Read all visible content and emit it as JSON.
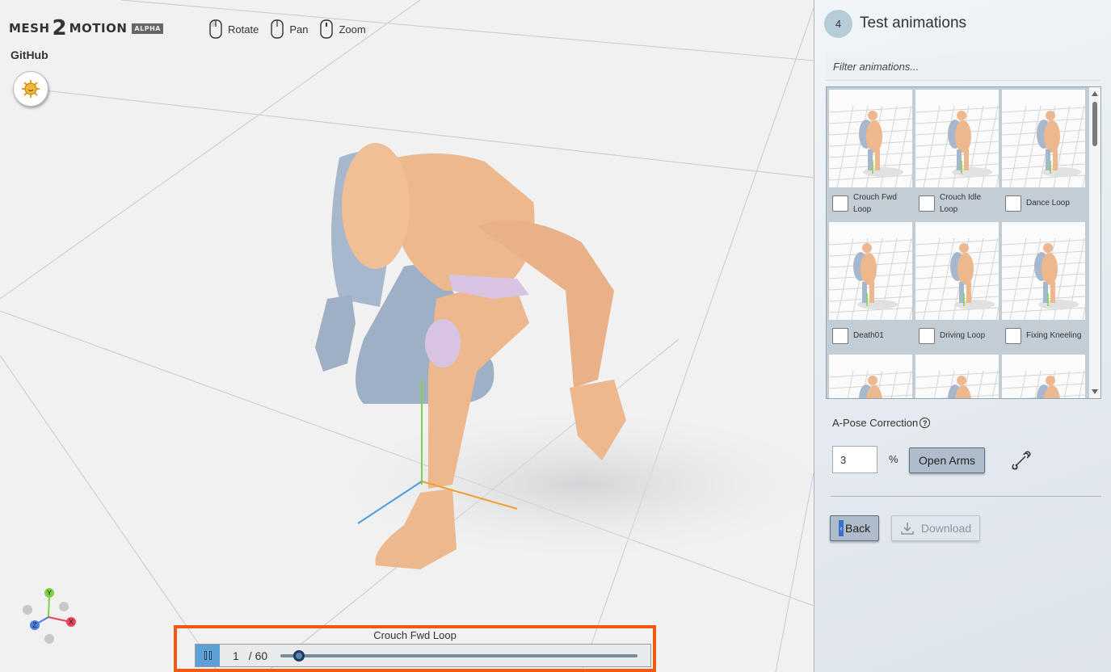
{
  "app": {
    "logo_word1": "MESH",
    "logo_two": "2",
    "logo_word2": "MOTION",
    "logo_badge": "ALPHA",
    "github_label": "GitHub",
    "theme_icon": "sun-icon"
  },
  "viewport_controls": [
    {
      "label": "Rotate",
      "icon": "mouse-left-icon"
    },
    {
      "label": "Pan",
      "icon": "mouse-middle-icon"
    },
    {
      "label": "Zoom",
      "icon": "mouse-scroll-icon"
    }
  ],
  "gizmo": {
    "x_label": "X",
    "y_label": "Y",
    "z_label": "Z",
    "x_color": "#e8455a",
    "y_color": "#7fd243",
    "z_color": "#4a7ee0"
  },
  "timeline": {
    "animation_name": "Crouch Fwd Loop",
    "current_frame": "1",
    "total_frames": "/ 60",
    "progress": 0.02
  },
  "panel": {
    "step_number": "4",
    "step_title": "Test animations",
    "filter_placeholder": "Filter animations...",
    "animations": [
      {
        "label": "Crouch Fwd Loop",
        "checked": false
      },
      {
        "label": "Crouch Idle Loop",
        "checked": false
      },
      {
        "label": "Dance Loop",
        "checked": false
      },
      {
        "label": "Death01",
        "checked": false
      },
      {
        "label": "Driving Loop",
        "checked": false
      },
      {
        "label": "Fixing Kneeling",
        "checked": false
      }
    ],
    "apose_label": "A-Pose Correction",
    "apose_value": "3",
    "percent_sign": "%",
    "open_arms_label": "Open Arms",
    "back_label": "Back",
    "download_label": "Download"
  },
  "colors": {
    "accent": "#5ea0d6",
    "highlight_border": "#f05a14",
    "character_skin": "#edb88d",
    "character_cloth": "#a8b8cc"
  }
}
